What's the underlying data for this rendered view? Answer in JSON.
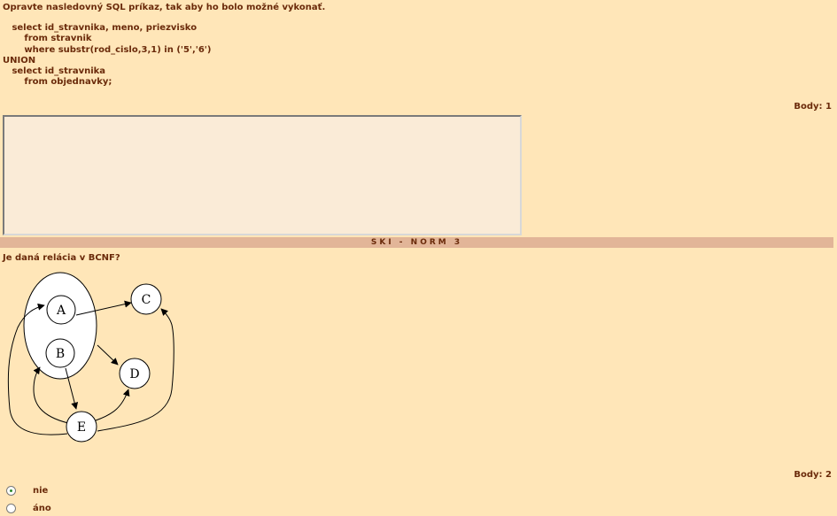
{
  "question1": {
    "title": "Opravte nasledovný SQL príkaz, tak aby ho bolo možné vykonať.",
    "sql": "   select id_stravnika, meno, priezvisko\n       from stravnik\n       where substr(rod_cislo,3,1) in ('5','6')\nUNION\n   select id_stravnika\n       from objednavky;",
    "points": "Body: 1",
    "answer_value": ""
  },
  "section": {
    "title": "SKI - NORM 3"
  },
  "question2": {
    "title": "Je daná relácia v BCNF?",
    "diagram": {
      "nodes": {
        "a": "A",
        "b": "B",
        "c": "C",
        "d": "D",
        "e": "E"
      }
    },
    "points": "Body: 2",
    "options": [
      {
        "label": "nie",
        "selected": true
      },
      {
        "label": "áno",
        "selected": false
      }
    ]
  }
}
